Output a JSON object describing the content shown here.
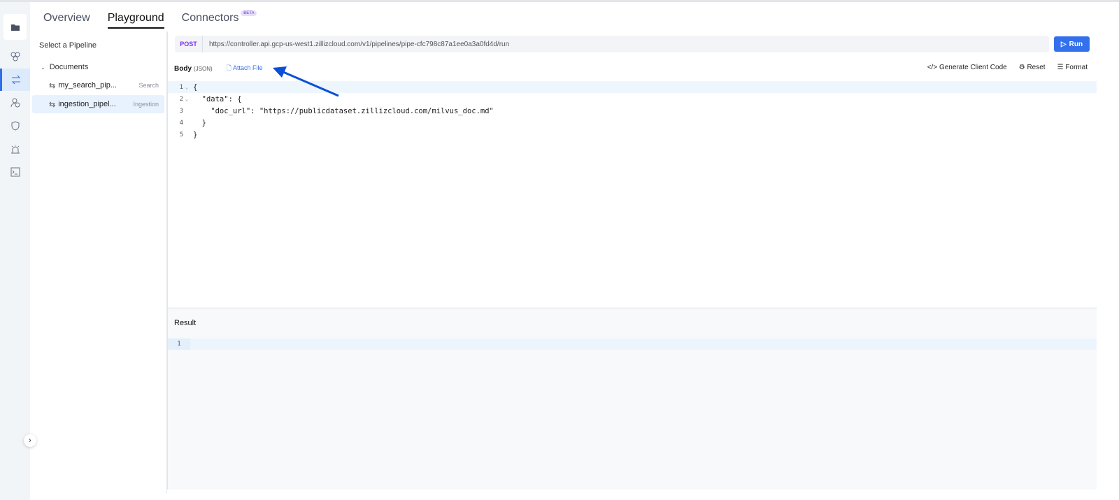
{
  "tabs": [
    {
      "label": "Overview"
    },
    {
      "label": "Playground",
      "active": true
    },
    {
      "label": "Connectors",
      "badge": "BETA"
    }
  ],
  "rail": {
    "icons": [
      "folder-icon",
      "clusters-icon",
      "pipelines-icon",
      "users-icon",
      "security-icon",
      "alerts-icon",
      "terminal-icon"
    ],
    "active": "pipelines-icon"
  },
  "panel": {
    "title": "Select a Pipeline",
    "group": "Documents",
    "items": [
      {
        "name": "my_search_pip...",
        "type": "Search"
      },
      {
        "name": "ingestion_pipel...",
        "type": "Ingestion",
        "active": true
      }
    ]
  },
  "request": {
    "method": "POST",
    "url": "https://controller.api.gcp-us-west1.zillizcloud.com/v1/pipelines/pipe-cfc798c87a1ee0a3a0fd4d/run",
    "run_label": "Run"
  },
  "body": {
    "label": "Body",
    "format": "(JSON)",
    "attach": "Attach File"
  },
  "actions": {
    "generate": "Generate Client Code",
    "reset": "Reset",
    "format": "Format"
  },
  "editor": {
    "lines": [
      {
        "n": "1",
        "code": "{"
      },
      {
        "n": "2",
        "code": "  \"data\": {"
      },
      {
        "n": "3",
        "key": "    \"doc_url\": ",
        "value": "\"https://publicdataset.zillizcloud.com/milvus_doc.md\""
      },
      {
        "n": "4",
        "code": "  }"
      },
      {
        "n": "5",
        "code": "}"
      }
    ]
  },
  "result": {
    "title": "Result",
    "line": "1"
  },
  "colors": {
    "accent": "#3370eb",
    "method": "#7b2ff7",
    "annotation_arrow": "#0b4fd8"
  }
}
